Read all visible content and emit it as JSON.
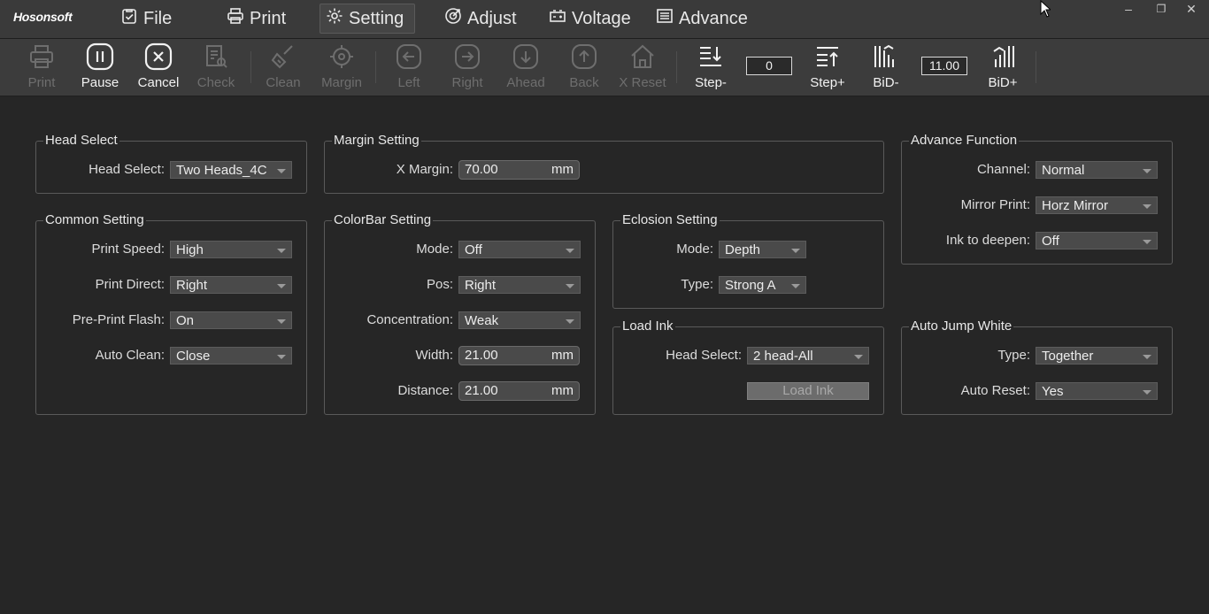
{
  "app": {
    "brand": "Hosonsoft"
  },
  "menu": [
    {
      "label": "File",
      "icon": "clipboard-check-icon"
    },
    {
      "label": "Print",
      "icon": "printer-icon"
    },
    {
      "label": "Setting",
      "icon": "gear-icon",
      "active": true
    },
    {
      "label": "Adjust",
      "icon": "target-icon"
    },
    {
      "label": "Voltage",
      "icon": "battery-icon"
    },
    {
      "label": "Advance",
      "icon": "list-icon"
    }
  ],
  "toolbar": {
    "print": "Print",
    "pause": "Pause",
    "cancel": "Cancel",
    "check": "Check",
    "clean": "Clean",
    "margin": "Margin",
    "left": "Left",
    "right": "Right",
    "ahead": "Ahead",
    "back": "Back",
    "x_reset": "X Reset",
    "step_minus": "Step-",
    "step_value": "0",
    "step_plus": "Step+",
    "bid_minus": "BiD-",
    "bid_value": "11.00",
    "bid_plus": "BiD+"
  },
  "head_select": {
    "title": "Head Select",
    "label": "Head Select:",
    "value": "Two Heads_4C"
  },
  "margin_setting": {
    "title": "Margin Setting",
    "x_margin_label": "X Margin:",
    "x_margin_value": "70.00",
    "unit": "mm"
  },
  "advance_function": {
    "title": "Advance Function",
    "channel_label": "Channel:",
    "channel_value": "Normal",
    "mirror_label": "Mirror Print:",
    "mirror_value": "Horz Mirror",
    "ink_label": "Ink to deepen:",
    "ink_value": "Off"
  },
  "common_setting": {
    "title": "Common Setting",
    "speed_label": "Print Speed:",
    "speed_value": "High",
    "direct_label": "Print Direct:",
    "direct_value": "Right",
    "flash_label": "Pre-Print Flash:",
    "flash_value": "On",
    "clean_label": "Auto Clean:",
    "clean_value": "Close"
  },
  "colorbar_setting": {
    "title": "ColorBar Setting",
    "mode_label": "Mode:",
    "mode_value": "Off",
    "pos_label": "Pos:",
    "pos_value": "Right",
    "conc_label": "Concentration:",
    "conc_value": "Weak",
    "width_label": "Width:",
    "width_value": "21.00",
    "distance_label": "Distance:",
    "distance_value": "21.00",
    "unit": "mm"
  },
  "eclosion_setting": {
    "title": "Eclosion Setting",
    "mode_label": "Mode:",
    "mode_value": "Depth",
    "type_label": "Type:",
    "type_value": "Strong A"
  },
  "load_ink": {
    "title": "Load Ink",
    "head_label": "Head Select:",
    "head_value": "2 head-All",
    "button": "Load Ink"
  },
  "auto_jump_white": {
    "title": "Auto Jump White",
    "type_label": "Type:",
    "type_value": "Together",
    "reset_label": "Auto Reset:",
    "reset_value": "Yes"
  },
  "colors": {
    "background": "#262626",
    "toolbar": "#3c3c3c",
    "titlebar": "#3a3a3a",
    "disabled": "#6e6e6e"
  }
}
